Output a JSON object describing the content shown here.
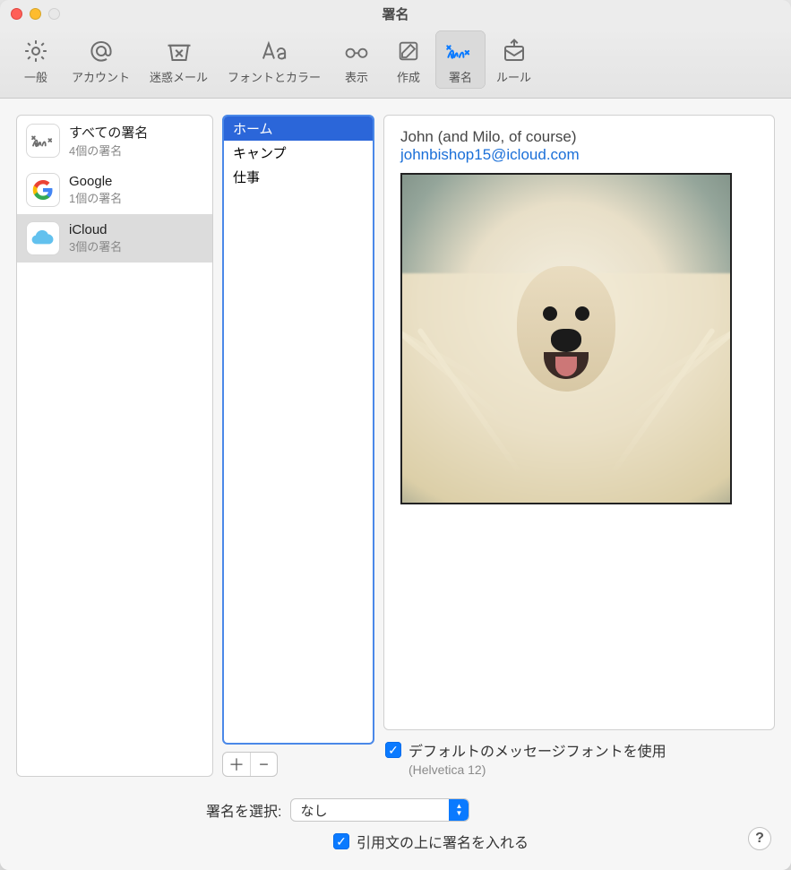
{
  "window": {
    "title": "署名"
  },
  "toolbar": {
    "items": [
      {
        "label": "一般",
        "icon": "gear-icon"
      },
      {
        "label": "アカウント",
        "icon": "at-icon"
      },
      {
        "label": "迷惑メール",
        "icon": "junk-icon"
      },
      {
        "label": "フォントとカラー",
        "icon": "font-icon"
      },
      {
        "label": "表示",
        "icon": "glasses-icon"
      },
      {
        "label": "作成",
        "icon": "compose-icon"
      },
      {
        "label": "署名",
        "icon": "signature-icon"
      },
      {
        "label": "ルール",
        "icon": "rules-icon"
      }
    ],
    "activeIndex": 6
  },
  "accounts": [
    {
      "name": "すべての署名",
      "sub": "4個の署名",
      "icon": "signature"
    },
    {
      "name": "Google",
      "sub": "1個の署名",
      "icon": "google"
    },
    {
      "name": "iCloud",
      "sub": "3個の署名",
      "icon": "icloud"
    }
  ],
  "accountsSelectedIndex": 2,
  "signatures": [
    "ホーム",
    "キャンプ",
    "仕事"
  ],
  "signaturesSelectedIndex": 0,
  "preview": {
    "line1": "John (and Milo, of course)",
    "email": "johnbishop15@icloud.com",
    "imageAlt": "dog-photo"
  },
  "options": {
    "useDefaultFontLabel": "デフォルトのメッセージフォントを使用",
    "useDefaultFontChecked": true,
    "fontNote": "(Helvetica 12)",
    "chooseSigLabel": "署名を選択:",
    "chooseSigValue": "なし",
    "placeAboveQuoteLabel": "引用文の上に署名を入れる",
    "placeAboveQuoteChecked": true
  },
  "buttons": {
    "add": "＋",
    "remove": "−",
    "help": "?"
  }
}
